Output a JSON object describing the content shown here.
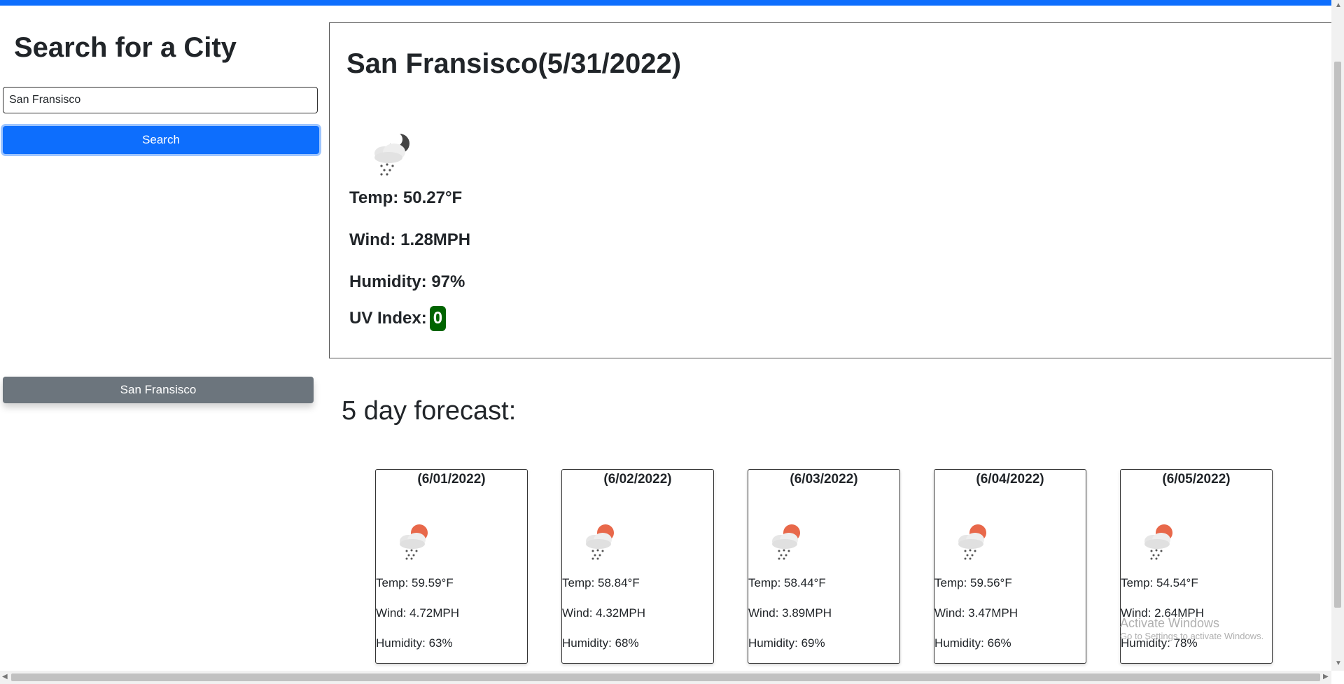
{
  "colors": {
    "accent": "#0d6efd",
    "history_button": "#6c757d",
    "uv_badge": "#006400"
  },
  "sidebar": {
    "heading": "Search for a City",
    "search_input_value": "San Fransisco",
    "search_button_label": "Search",
    "history": [
      {
        "label": "San Fransisco"
      }
    ]
  },
  "current": {
    "title": "San Fransisco(5/31/2022)",
    "icon": "snow-night-icon",
    "temp": "Temp: 50.27°F",
    "wind": "Wind: 1.28MPH",
    "humidity": "Humidity: 97%",
    "uv_label": "UV Index:",
    "uv_value": "0"
  },
  "forecast": {
    "heading": "5 day forecast:",
    "days": [
      {
        "date": "(6/01/2022)",
        "icon": "snow-day-icon",
        "temp": "Temp: 59.59°F",
        "wind": "Wind: 4.72MPH",
        "humidity": "Humidity: 63%"
      },
      {
        "date": "(6/02/2022)",
        "icon": "snow-day-icon",
        "temp": "Temp: 58.84°F",
        "wind": "Wind: 4.32MPH",
        "humidity": "Humidity: 68%"
      },
      {
        "date": "(6/03/2022)",
        "icon": "snow-day-icon",
        "temp": "Temp: 58.44°F",
        "wind": "Wind: 3.89MPH",
        "humidity": "Humidity: 69%"
      },
      {
        "date": "(6/04/2022)",
        "icon": "snow-day-icon",
        "temp": "Temp: 59.56°F",
        "wind": "Wind: 3.47MPH",
        "humidity": "Humidity: 66%"
      },
      {
        "date": "(6/05/2022)",
        "icon": "snow-day-icon",
        "temp": "Temp: 54.54°F",
        "wind": "Wind: 2.64MPH",
        "humidity": "Humidity: 78%"
      }
    ]
  },
  "watermark": {
    "title": "Activate Windows",
    "subtitle": "Go to Settings to activate Windows."
  }
}
